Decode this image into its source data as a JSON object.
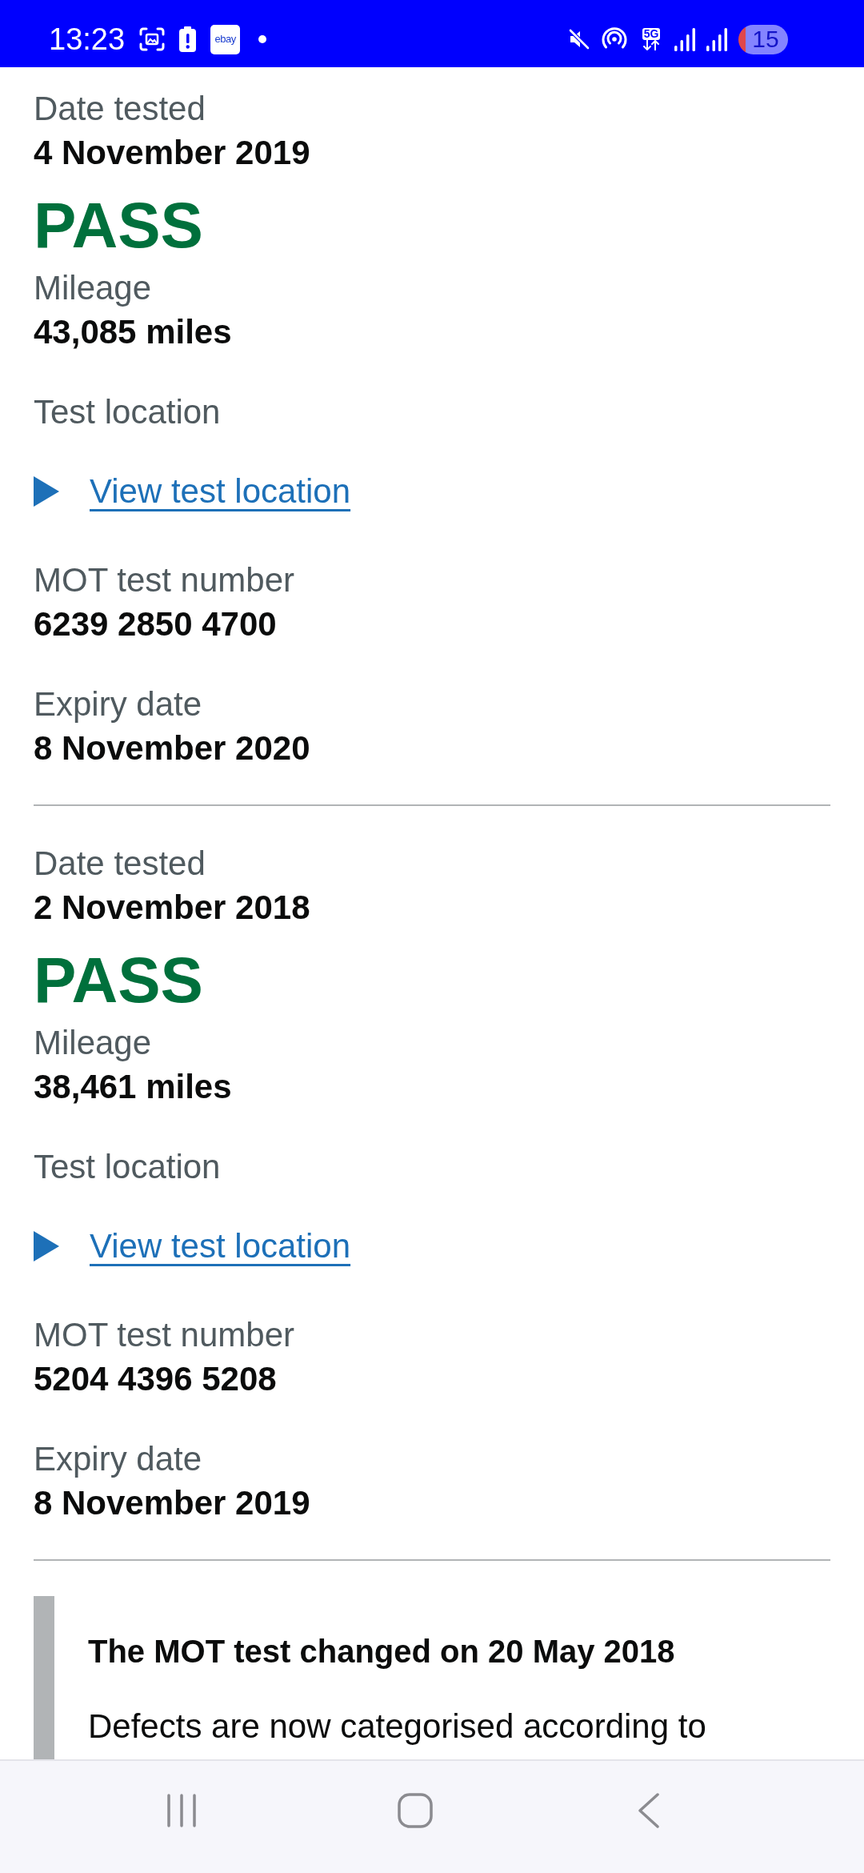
{
  "status_bar": {
    "time": "13:23",
    "notification_app_label": "ebay",
    "network_type": "5G",
    "battery_percent": "15"
  },
  "records": [
    {
      "date_label": "Date tested",
      "date": "4 November 2019",
      "result": "PASS",
      "mileage_label": "Mileage",
      "mileage": "43,085 miles",
      "location_label": "Test location",
      "location_link": "View test location",
      "expanded": false,
      "test_number_label": "MOT test number",
      "test_number": "6239 2850 4700",
      "expiry_label": "Expiry date",
      "expiry": "8 November 2020"
    },
    {
      "date_label": "Date tested",
      "date": "2 November 2018",
      "result": "PASS",
      "mileage_label": "Mileage",
      "mileage": "38,461 miles",
      "location_label": "Test location",
      "location_link": "View test location",
      "expanded": false,
      "test_number_label": "MOT test number",
      "test_number": "5204 4396 5208",
      "expiry_label": "Expiry date",
      "expiry": "8 November 2019"
    }
  ],
  "notice": {
    "heading": "The MOT test changed on 20 May 2018",
    "text": "Defects are now categorised according to"
  }
}
